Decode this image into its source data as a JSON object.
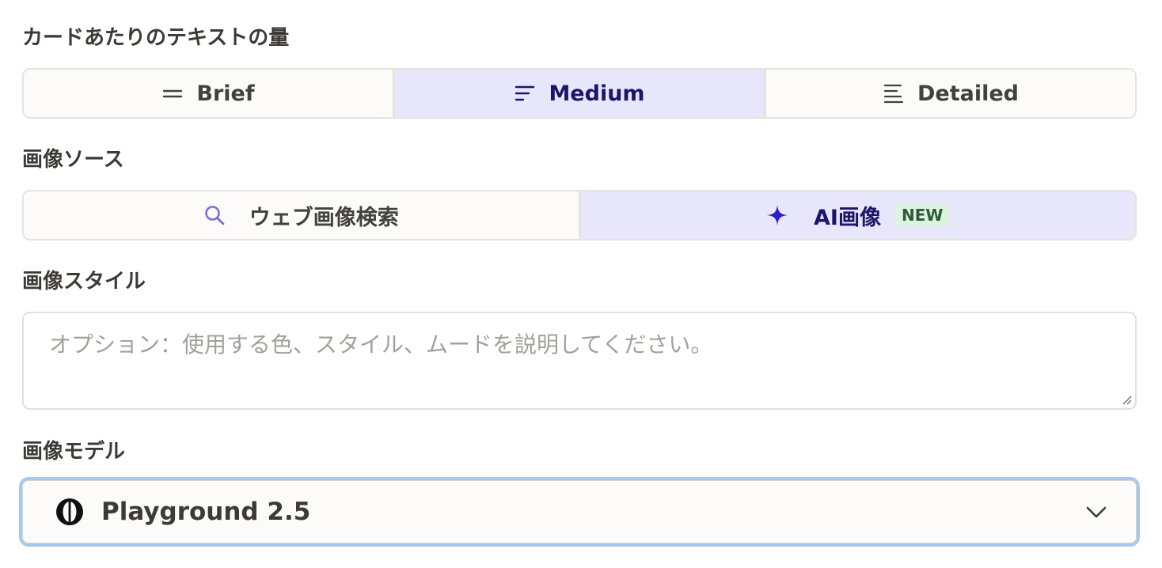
{
  "text_amount": {
    "label": "カードあたりのテキストの量",
    "options": [
      {
        "label": "Brief",
        "icon": "equals-lines-icon",
        "selected": false
      },
      {
        "label": "Medium",
        "icon": "short-lines-icon",
        "selected": true
      },
      {
        "label": "Detailed",
        "icon": "long-lines-icon",
        "selected": false
      }
    ]
  },
  "image_source": {
    "label": "画像ソース",
    "options": [
      {
        "label": "ウェブ画像検索",
        "icon": "search-icon",
        "selected": false
      },
      {
        "label": "AI画像",
        "icon": "sparkle-icon",
        "badge": "NEW",
        "selected": true
      }
    ]
  },
  "image_style": {
    "label": "画像スタイル",
    "value": "",
    "placeholder": "オプション：使用する色、スタイル、ムードを説明してください。"
  },
  "image_model": {
    "label": "画像モデル",
    "value": "Playground 2.5",
    "icon": "playground-logo-icon"
  },
  "colors": {
    "selected_bg": "#e7e6fb",
    "selected_text": "#1c1668",
    "accent_icon": "#2b1fd0",
    "search_icon": "#7a70d8",
    "badge_bg": "#dcf3e0",
    "badge_text": "#2e5a37",
    "focus_ring": "#a8c8ec"
  }
}
